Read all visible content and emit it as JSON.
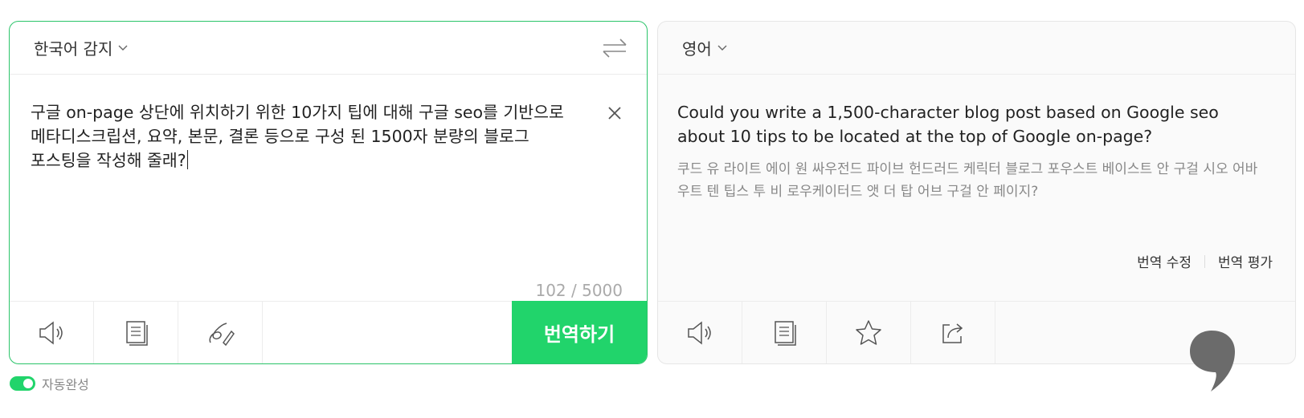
{
  "source": {
    "language": "한국어 감지",
    "text": "구글 on-page 상단에 위치하기 위한 10가지 팁에 대해 구글 seo를 기반으로 메타디스크립션, 요약, 본문, 결론 등으로 구성 된 1500자 분량의 블로그 포스팅을 작성해 줄래?",
    "char_count": "102 / 5000",
    "translate_button": "번역하기",
    "tools": [
      "speaker-icon",
      "copy-icon",
      "handwriting-icon"
    ]
  },
  "target": {
    "language": "영어",
    "text": "Could you write a 1,500-character blog post based on Google seo about 10 tips to be located at the top of Google on-page?",
    "pronunciation": "쿠드 유 라이트 에이 원 싸우전드 파이브 헌드러드 케릭터 블로그 포우스트 베이스트 안 구걸 시오 어바우트 텐 팁스 투 비 로우케이터드 앳 더 탑 어브 구걸 안 페이지?",
    "edit_translation": "번역 수정",
    "rate_translation": "번역 평가",
    "tools": [
      "speaker-icon",
      "copy-icon",
      "star-icon",
      "share-icon"
    ]
  },
  "autocomplete": {
    "label": "자동완성",
    "enabled": true
  },
  "colors": {
    "accent": "#21d46b",
    "border_active": "#2bc46a"
  }
}
